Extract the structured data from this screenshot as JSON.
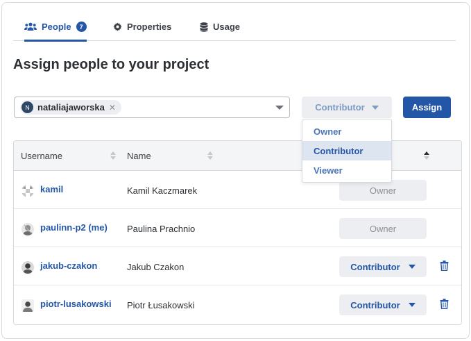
{
  "tabs": [
    {
      "label": "People",
      "icon": "users-icon",
      "badge": "7",
      "active": true
    },
    {
      "label": "Properties",
      "icon": "gear-icon"
    },
    {
      "label": "Usage",
      "icon": "database-icon"
    }
  ],
  "page_title": "Assign people to your project",
  "assign_form": {
    "selected_user": "nataliajaworska",
    "selected_user_initial": "N",
    "role_value": "Contributor",
    "assign_label": "Assign"
  },
  "role_menu": {
    "options": [
      "Owner",
      "Contributor",
      "Viewer"
    ],
    "selected": "Contributor"
  },
  "table": {
    "columns": [
      "Username",
      "Name"
    ],
    "rows": [
      {
        "username": "kamil",
        "name": "Kamil Kaczmarek",
        "role": "Owner",
        "editable": false
      },
      {
        "username": "paulinn-p2 (me)",
        "name": "Paulina Prachnio",
        "role": "Owner",
        "editable": false
      },
      {
        "username": "jakub-czakon",
        "name": "Jakub Czakon",
        "role": "Contributor",
        "editable": true
      },
      {
        "username": "piotr-lusakowski",
        "name": "Piotr Łusakowski",
        "role": "Contributor",
        "editable": true
      }
    ]
  },
  "colors": {
    "accent": "#2456a8",
    "muted_button_bg": "#eceef1",
    "menu_selected_bg": "#dde5f1"
  }
}
